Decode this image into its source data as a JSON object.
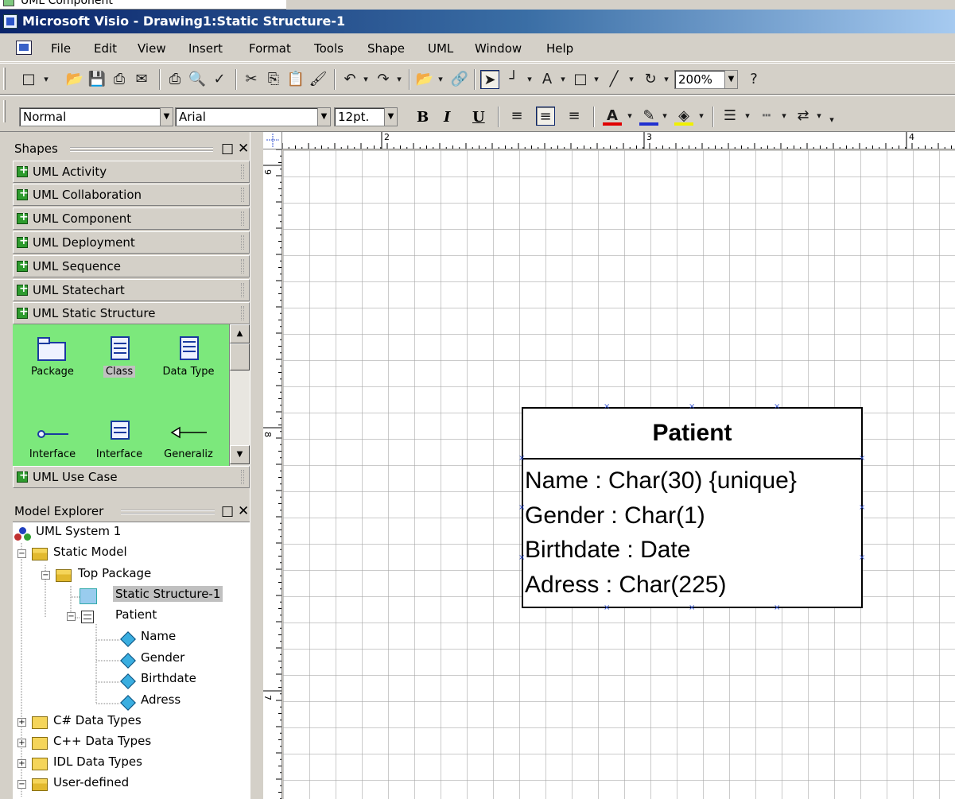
{
  "previous_window": {
    "label": "UML Component"
  },
  "titlebar": {
    "title": "Microsoft Visio - Drawing1:Static Structure-1"
  },
  "menu": [
    "File",
    "Edit",
    "View",
    "Insert",
    "Format",
    "Tools",
    "Shape",
    "UML",
    "Window",
    "Help"
  ],
  "toolbar": {
    "zoom": "200%",
    "style": "Normal",
    "font": "Arial",
    "font_size": "12pt.",
    "bold": "B",
    "italic": "I",
    "underline": "U",
    "font_color_glyph": "A",
    "text_tool_glyph": "A"
  },
  "shapes_panel": {
    "title": "Shapes",
    "stencils": [
      "UML Activity",
      "UML Collaboration",
      "UML Component",
      "UML Deployment",
      "UML Sequence",
      "UML Statechart",
      "UML Static Structure"
    ],
    "shapes": [
      "Package",
      "Class",
      "Data Type",
      "Interface",
      "Interface",
      "Generaliz"
    ],
    "selected_shape": "Class",
    "bottom_stencil": "UML Use Case"
  },
  "model_explorer": {
    "title": "Model Explorer",
    "items": [
      "UML System 1",
      "Static Model",
      "Top Package",
      "Static Structure-1",
      "Patient",
      "Name",
      "Gender",
      "Birthdate",
      "Adress",
      "C# Data Types",
      "C++ Data Types",
      "IDL Data Types",
      "User-defined"
    ],
    "selected": "Static Structure-1"
  },
  "rulers": {
    "horizontal_labels": [
      "2",
      "3",
      "4"
    ],
    "vertical_labels": [
      "9",
      "8",
      "7"
    ]
  },
  "diagram": {
    "class_name": "Patient",
    "attributes": [
      "Name : Char(30) {unique}",
      "Gender : Char(1)",
      "Birthdate : Date",
      "Adress : Char(225)"
    ]
  },
  "colors": {
    "title_gradient_start": "#0a246a",
    "title_gradient_end": "#a6caf0",
    "chrome": "#d4d0c8",
    "stencil_background": "#7ce87c",
    "selection_handle": "#3050d0"
  }
}
